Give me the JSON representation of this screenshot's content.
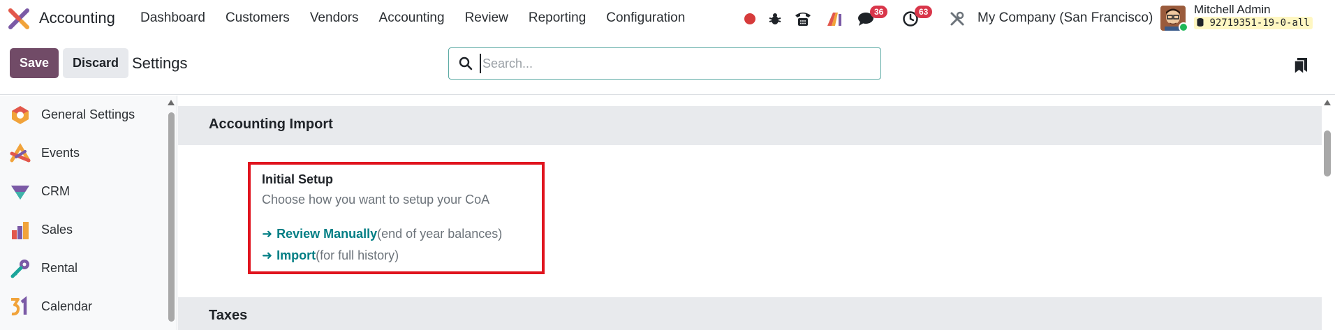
{
  "navbar": {
    "app_title": "Accounting",
    "menu": [
      "Dashboard",
      "Customers",
      "Vendors",
      "Accounting",
      "Review",
      "Reporting",
      "Configuration"
    ],
    "messages_count": "36",
    "activities_count": "63",
    "company": "My Company (San Francisco)",
    "user_name": "Mitchell Admin",
    "db_name": "92719351-19-0-all",
    "icons": [
      "record-icon",
      "bug-icon",
      "phone-icon",
      "ai-icon",
      "chat-icon",
      "clock-icon",
      "tools-icon"
    ]
  },
  "control": {
    "save_label": "Save",
    "discard_label": "Discard",
    "title": "Settings",
    "search_placeholder": "Search..."
  },
  "sidebar": {
    "items": [
      {
        "label": "General Settings",
        "icon": "general-settings-icon"
      },
      {
        "label": "Events",
        "icon": "events-icon"
      },
      {
        "label": "CRM",
        "icon": "crm-icon"
      },
      {
        "label": "Sales",
        "icon": "sales-icon"
      },
      {
        "label": "Rental",
        "icon": "rental-icon"
      },
      {
        "label": "Calendar",
        "icon": "calendar-icon"
      }
    ]
  },
  "main": {
    "sections": [
      {
        "title": "Accounting Import"
      },
      {
        "title": "Taxes"
      }
    ],
    "setting": {
      "title": "Initial Setup",
      "description": "Choose how you want to setup your CoA",
      "links": [
        {
          "label": "Review Manually",
          "hint": "(end of year balances)"
        },
        {
          "label": "Import",
          "hint": "(for full history)"
        }
      ]
    }
  },
  "colors": {
    "brand": "#714b67",
    "link": "#017e84",
    "highlight": "#e0141e",
    "badge": "#d9364a"
  }
}
